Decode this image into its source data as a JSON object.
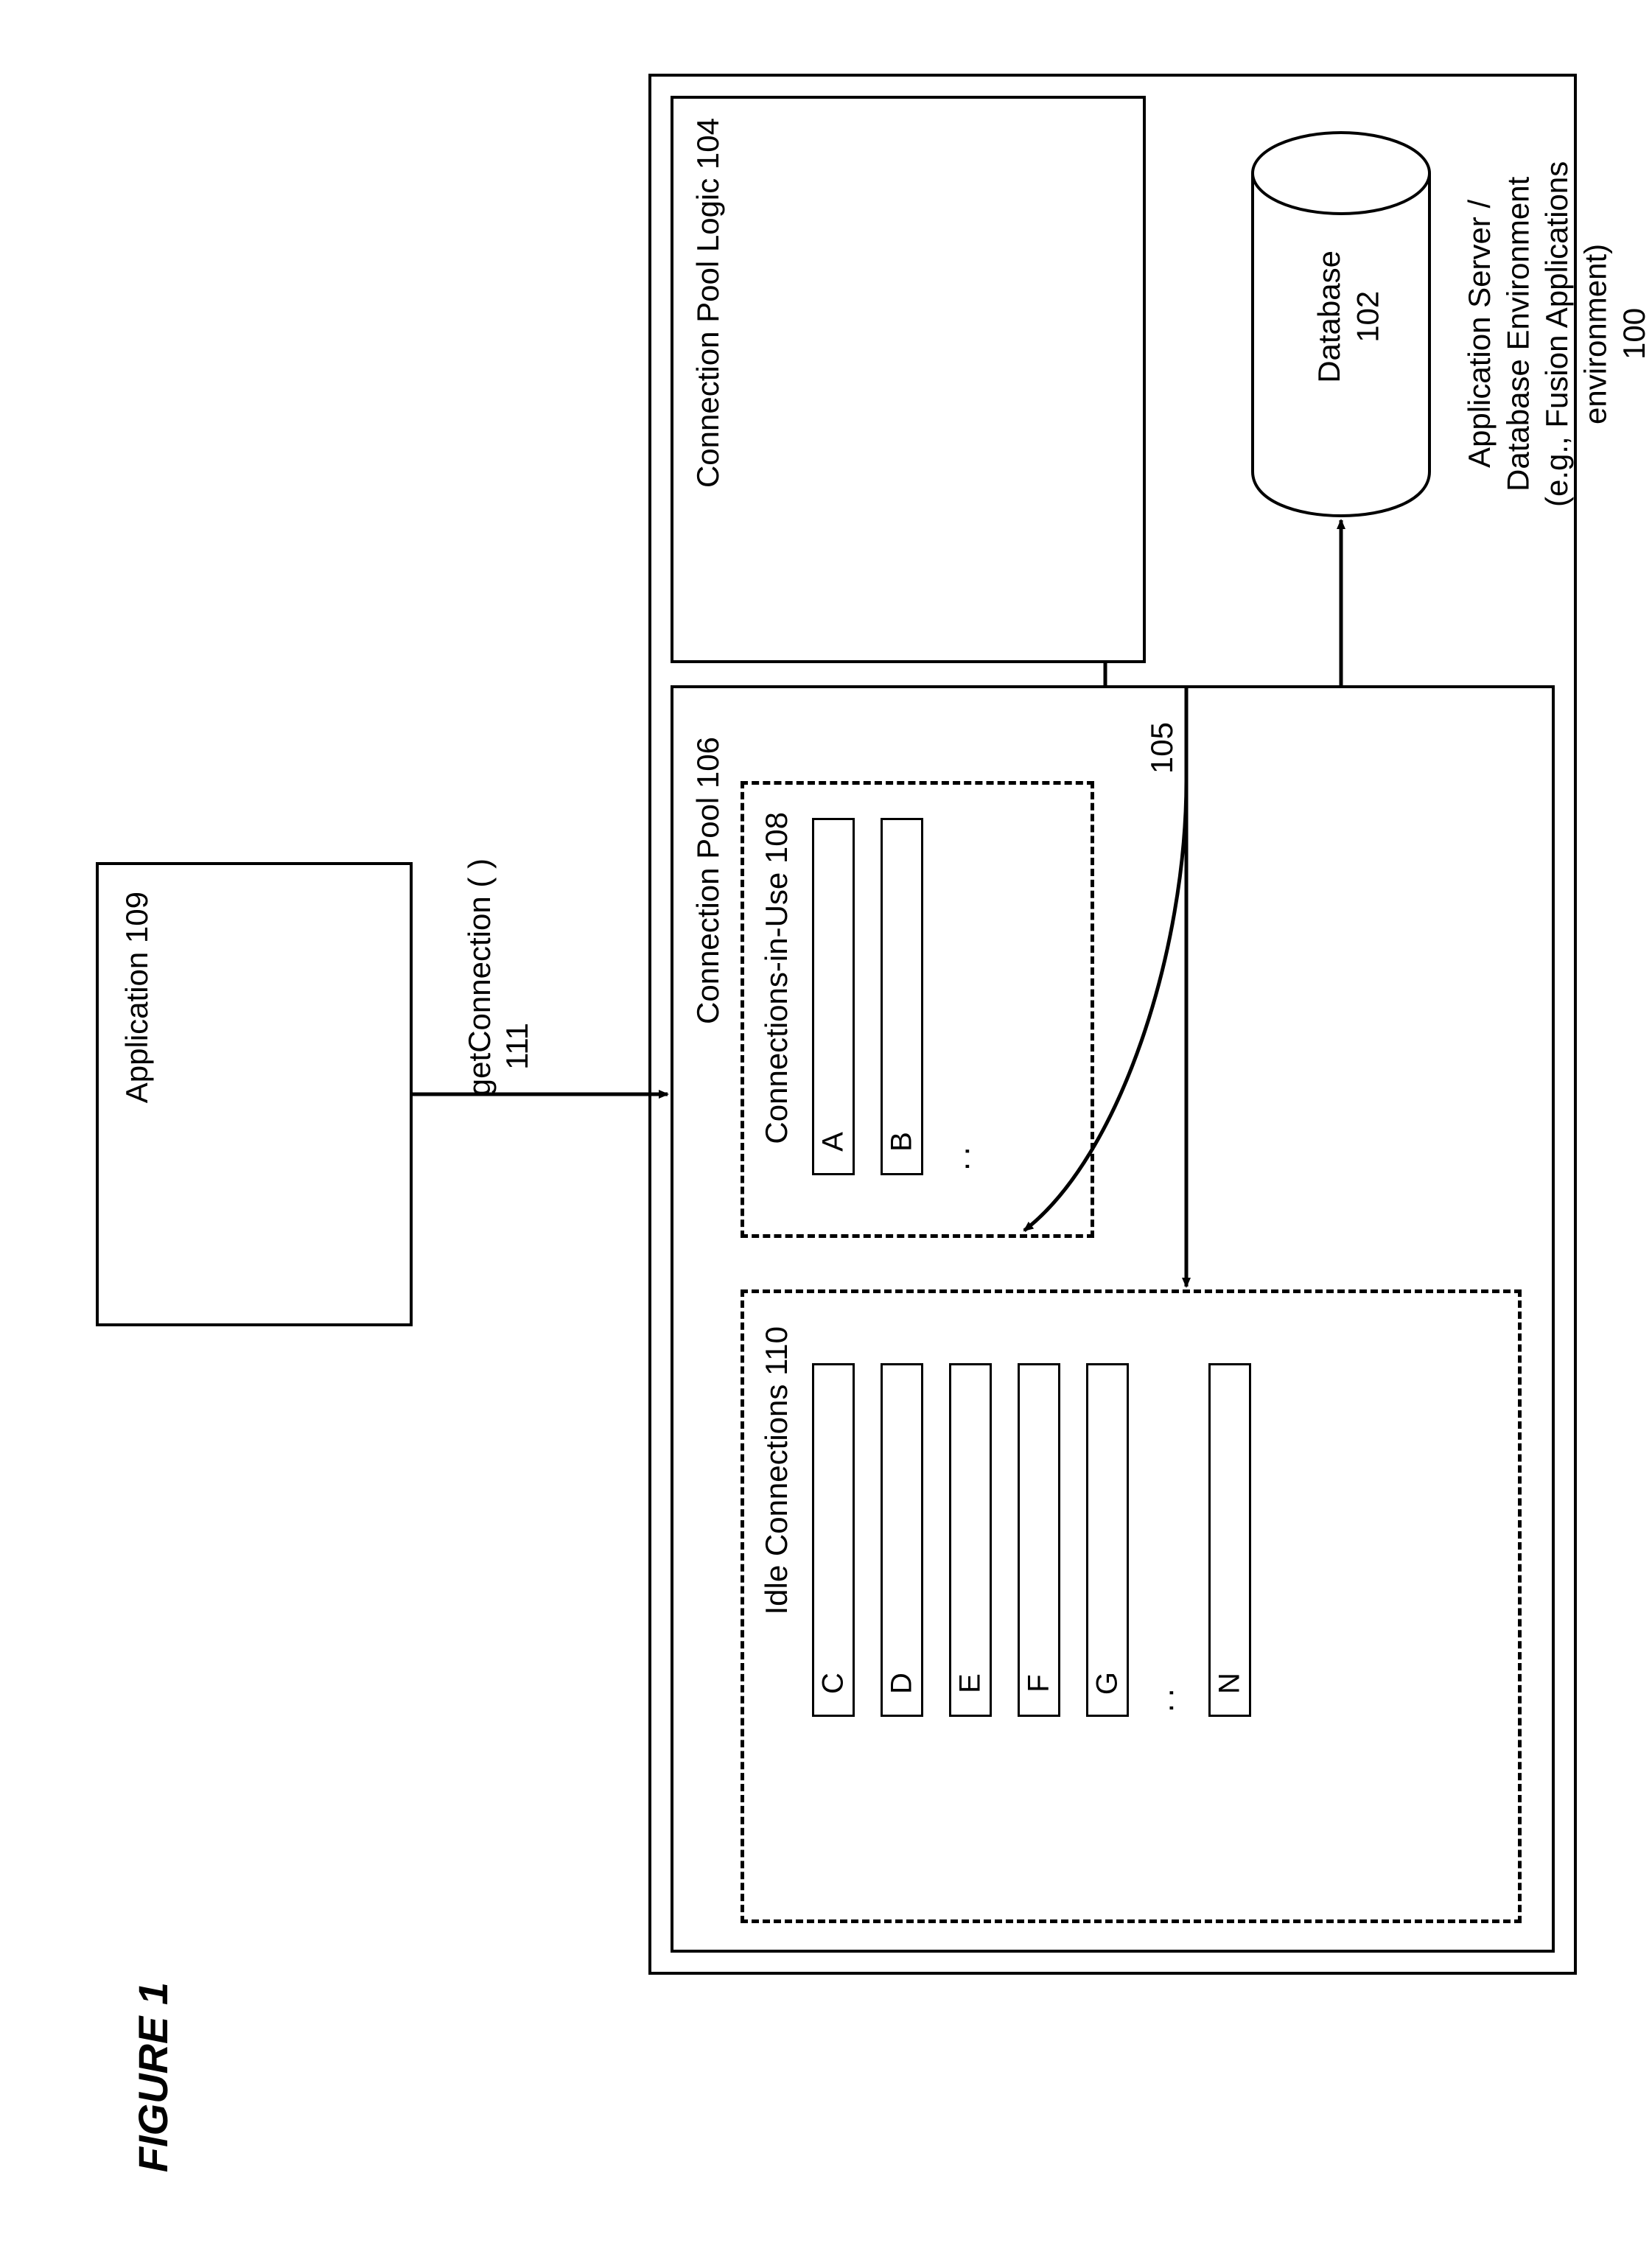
{
  "figure_label": "FIGURE 1",
  "application": {
    "label": "Application 109"
  },
  "get_connection": {
    "label": "getConnection ( )",
    "num": "111"
  },
  "environment": {
    "title_lines": [
      "Application Server /",
      "Database Environment",
      "(e.g., Fusion Applications",
      "environment)",
      "100"
    ]
  },
  "database": {
    "label": "Database",
    "num": "102"
  },
  "pool_logic": {
    "label": "Connection Pool Logic 104"
  },
  "pool": {
    "label": "Connection Pool 106",
    "arrow_num": "105"
  },
  "in_use": {
    "label": "Connections-in-Use 108",
    "slots": [
      "A",
      "B"
    ]
  },
  "idle": {
    "label": "Idle Connections 110",
    "slots": [
      "C",
      "D",
      "E",
      "F",
      "G",
      "N"
    ]
  }
}
